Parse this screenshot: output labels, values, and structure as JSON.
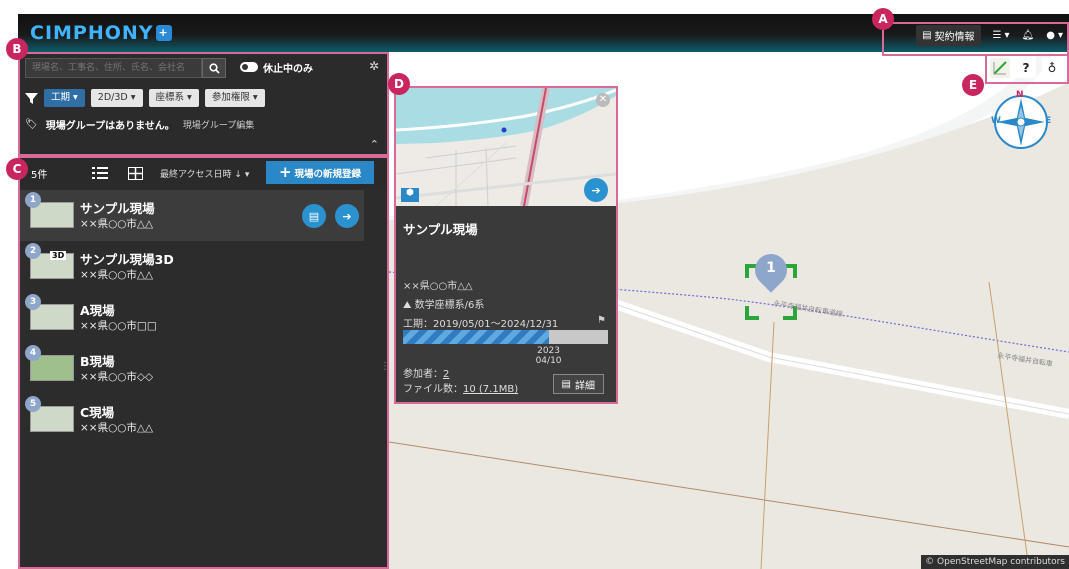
{
  "topbar": {
    "logo_text": "CIMPHONY",
    "logo_plus": "+",
    "contract_label": "契約情報"
  },
  "panel_b": {
    "search_placeholder": "現場名、工事名、住所、氏名、会社名",
    "toggle_label": "休止中のみ",
    "filters": [
      "工期 ▾",
      "2D/3D ▾",
      "座標系 ▾",
      "参加権限 ▾"
    ],
    "no_group_text": "現場グループはありません。",
    "group_edit_label": "現場グループ編集"
  },
  "list_header": {
    "count_label": "5件",
    "sort_label": "最終アクセス日時 ↓ ▾",
    "new_site_label": "現場の新規登録"
  },
  "sites": [
    {
      "num": "1",
      "name": "サンプル現場",
      "address": "××県○○市△△",
      "badge": ""
    },
    {
      "num": "2",
      "name": "サンプル現場3D",
      "address": "××県○○市△△",
      "badge": "3D"
    },
    {
      "num": "3",
      "name": "A現場",
      "address": "××県○○市□□",
      "badge": ""
    },
    {
      "num": "4",
      "name": "B現場",
      "address": "××県○○市◇◇",
      "badge": ""
    },
    {
      "num": "5",
      "name": "C現場",
      "address": "××県○○市△△",
      "badge": ""
    }
  ],
  "popup": {
    "title": "サンプル現場",
    "address": "××県○○市△△",
    "coord_system": "数学座標系/6系",
    "period": "工期：2019/05/01～2024/12/31",
    "progress_fraction": 0.71,
    "progress_year": "2023",
    "progress_date": "04/10",
    "members_label": "参加者：",
    "members_value": "2",
    "files_label": "ファイル数：",
    "files_value": "10 (7.1MB)",
    "detail_label": "詳細"
  },
  "map": {
    "marker_number": "1",
    "road_label_1": "永平寺福井自転車道線",
    "road_label_2": "永平寺福井自転車",
    "attribution": "© OpenStreetMap contributors",
    "compass": {
      "n": "N",
      "e": "E",
      "w": "W"
    }
  },
  "callouts": {
    "a": "A",
    "b": "B",
    "c": "C",
    "d": "D",
    "e": "E"
  },
  "colors": {
    "accent": "#2a88c9",
    "callout": "#c9255f",
    "outline": "#d86a9a",
    "panel": "#2c2c2c"
  }
}
